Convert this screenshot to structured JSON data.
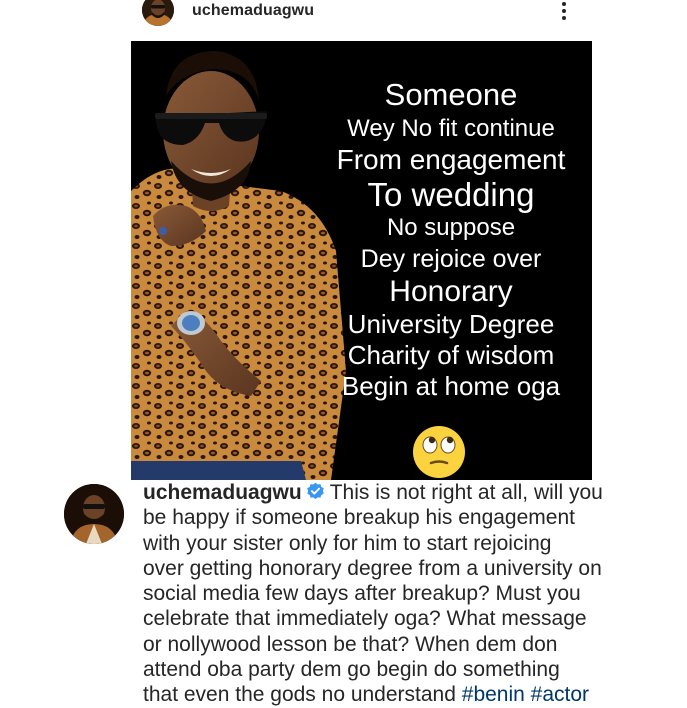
{
  "post": {
    "username": "uchemaduagwu",
    "more_icon": "more-vertical-icon"
  },
  "image": {
    "caption_lines": [
      "Someone",
      "Wey  No fit continue",
      "From engagement",
      "To wedding",
      "No suppose",
      "Dey rejoice over",
      "Honorary",
      "University Degree",
      "Charity of wisdom",
      "Begin at home oga"
    ],
    "emoji": "face-with-rolling-eyes-emoji",
    "background_color": "#000000"
  },
  "comment": {
    "username": "uchemaduagwu",
    "verified_icon": "verified-badge-icon",
    "text_lines": [
      "This is not right at all, will you",
      "be happy if someone breakup his engagement",
      "with your sister only for him to start rejoicing",
      "over getting honorary degree from a university on",
      "social media few days after breakup? Must you",
      "celebrate that immediately oga? What message",
      "or nollywood lesson be that? When dem don",
      "attend oba party dem go begin do something",
      "that even the gods no understand"
    ],
    "hashtags": [
      "#benin",
      "#actor"
    ]
  },
  "colors": {
    "text": "#262626",
    "hashtag": "#00376b",
    "verified": "#3897f0"
  }
}
